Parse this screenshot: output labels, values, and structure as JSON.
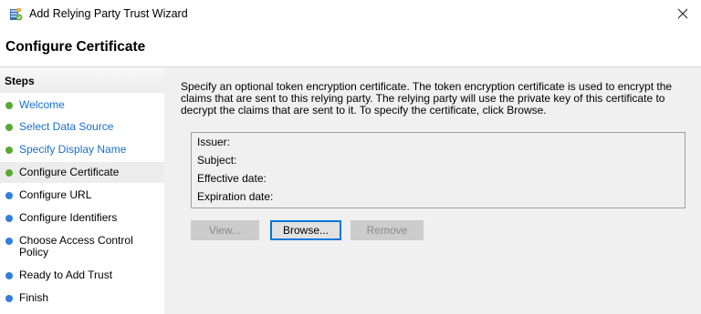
{
  "window": {
    "title": "Add Relying Party Trust Wizard",
    "close_icon": "close-icon"
  },
  "page": {
    "title": "Configure Certificate"
  },
  "steps": {
    "header": "Steps",
    "items": [
      {
        "label": "Welcome",
        "state": "done"
      },
      {
        "label": "Select Data Source",
        "state": "done"
      },
      {
        "label": "Specify Display Name",
        "state": "done"
      },
      {
        "label": "Configure Certificate",
        "state": "current"
      },
      {
        "label": "Configure URL",
        "state": "pending"
      },
      {
        "label": "Configure Identifiers",
        "state": "pending"
      },
      {
        "label": "Choose Access Control Policy",
        "state": "pending"
      },
      {
        "label": "Ready to Add Trust",
        "state": "pending"
      },
      {
        "label": "Finish",
        "state": "pending"
      }
    ]
  },
  "content": {
    "description": "Specify an optional token encryption certificate.  The token encryption certificate is used to encrypt the claims that are sent to this relying party.  The relying party will use the private key of this certificate to decrypt the claims that are sent to it.  To specify the certificate, click Browse.",
    "certificate": {
      "issuer_label": "Issuer:",
      "subject_label": "Subject:",
      "effective_label": "Effective date:",
      "expiration_label": "Expiration date:"
    },
    "buttons": {
      "view": "View...",
      "browse": "Browse...",
      "remove": "Remove"
    }
  },
  "colors": {
    "done_dot": "#5aa832",
    "current_dot": "#5aa832",
    "pending_dot": "#2f7fd8",
    "link_text": "#0066cc",
    "focus_border": "#0078d7"
  }
}
